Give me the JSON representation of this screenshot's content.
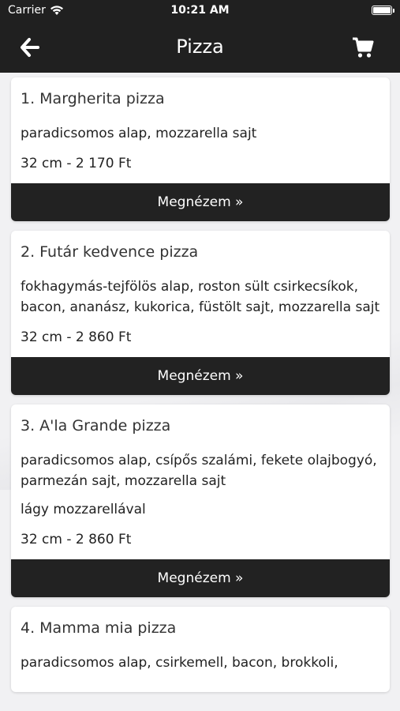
{
  "status_bar": {
    "carrier": "Carrier",
    "time": "10:21 AM"
  },
  "header": {
    "title": "Pizza",
    "back_icon": "arrow-left-icon",
    "cart_icon": "cart-icon"
  },
  "colors": {
    "header_bg": "#202020",
    "button_bg": "#222222"
  },
  "items": [
    {
      "title": "1. Margherita pizza",
      "description": "paradicsomos alap, mozzarella sajt",
      "note": "",
      "price": "32 cm - 2 170 Ft",
      "button": "Megnézem »"
    },
    {
      "title": "2. Futár kedvence pizza",
      "description": "fokhagymás-tejfölös alap, roston sült csirkecsíkok, bacon, ananász, kukorica, füstölt sajt, mozzarella sajt",
      "note": "",
      "price": "32 cm - 2 860 Ft",
      "button": "Megnézem »"
    },
    {
      "title": "3. A'la Grande pizza",
      "description": "paradicsomos alap, csípős szalámi, fekete olajbogyó, parmezán sajt, mozzarella sajt",
      "note": "lágy mozzarellával",
      "price": "32 cm - 2 860 Ft",
      "button": "Megnézem »"
    },
    {
      "title": "4. Mamma mia pizza",
      "description": "paradicsomos alap, csirkemell, bacon, brokkoli,",
      "note": "",
      "price": "",
      "button": ""
    }
  ]
}
